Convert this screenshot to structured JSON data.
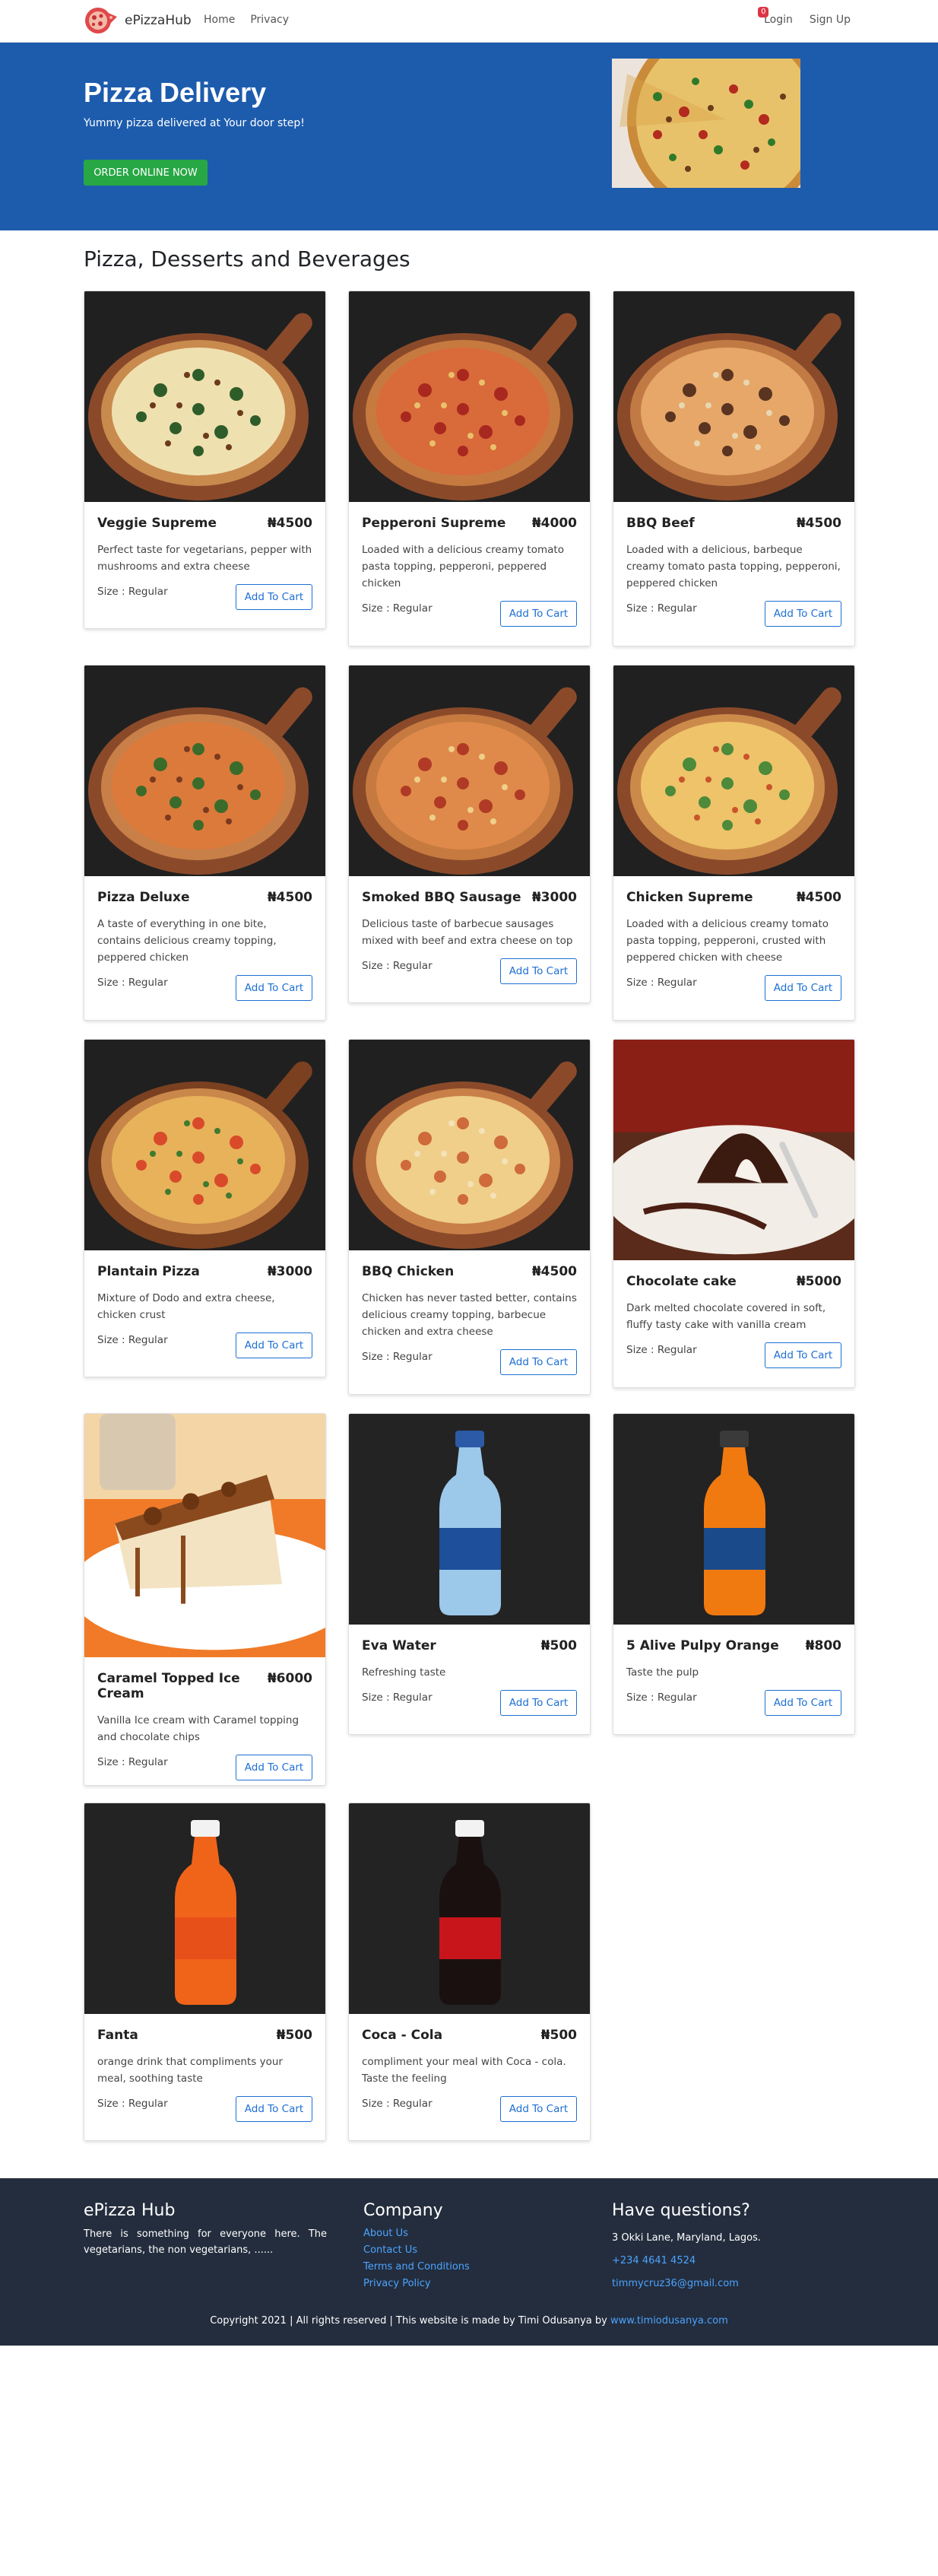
{
  "navbar": {
    "brand": "ePizzaHub",
    "links": [
      "Home",
      "Privacy"
    ],
    "cart_count": "0",
    "login": "Login",
    "signup": "Sign Up"
  },
  "hero": {
    "title": "Pizza Delivery",
    "subtitle": "Yummy pizza delivered at Your door step!",
    "button": "ORDER ONLINE NOW"
  },
  "section_title": "Pizza, Desserts and Beverages",
  "labels": {
    "size": "Size : Regular",
    "add_to_cart": "Add To Cart"
  },
  "products": [
    {
      "name": "Veggie Supreme",
      "price": "₦4500",
      "description": "Perfect taste for vegetarians, pepper with mushrooms and extra cheese",
      "image": "pizza-veggie"
    },
    {
      "name": "Pepperoni Supreme",
      "price": "₦4000",
      "description": "Loaded with a delicious creamy tomato pasta topping, pepperoni, peppered chicken",
      "image": "pizza-pepperoni"
    },
    {
      "name": "BBQ Beef",
      "price": "₦4500",
      "description": "Loaded with a delicious, barbeque creamy tomato pasta topping, pepperoni, peppered chicken",
      "image": "pizza-bbq-beef"
    },
    {
      "name": "Pizza Deluxe",
      "price": "₦4500",
      "description": "A taste of everything in one bite, contains delicious creamy topping, peppered chicken",
      "image": "pizza-deluxe"
    },
    {
      "name": "Smoked BBQ Sausage",
      "price": "₦3000",
      "description": "Delicious taste of barbecue sausages mixed with beef and extra cheese on top",
      "image": "pizza-sausage"
    },
    {
      "name": "Chicken Supreme",
      "price": "₦4500",
      "description": "Loaded with a delicious creamy tomato pasta topping, pepperoni, crusted with peppered chicken with cheese",
      "image": "pizza-chicken"
    },
    {
      "name": "Plantain Pizza",
      "price": "₦3000",
      "description": "Mixture of Dodo and extra cheese, chicken crust",
      "image": "pizza-plantain"
    },
    {
      "name": "BBQ Chicken",
      "price": "₦4500",
      "description": "Chicken has never tasted better, contains delicious creamy topping, barbecue chicken and extra cheese",
      "image": "pizza-bbq-chicken"
    },
    {
      "name": "Chocolate cake",
      "price": "₦5000",
      "description": "Dark melted chocolate covered in soft, fluffy tasty cake with vanilla cream",
      "image": "chocolate-cake"
    },
    {
      "name": "Caramel Topped Ice Cream",
      "price": "₦6000",
      "description": "Vanilla Ice cream with Caramel topping and chocolate chips",
      "image": "caramel-ice-cream"
    },
    {
      "name": "Eva Water",
      "price": "₦500",
      "description": "Refreshing taste",
      "image": "water-bottle"
    },
    {
      "name": "5 Alive Pulpy Orange",
      "price": "₦800",
      "description": "Taste the pulp",
      "image": "orange-bottle"
    },
    {
      "name": "Fanta",
      "price": "₦500",
      "description": "orange drink that compliments your meal, soothing taste",
      "image": "fanta-bottle"
    },
    {
      "name": "Coca - Cola",
      "price": "₦500",
      "description": "compliment your meal with Coca - cola. Taste the feeling",
      "image": "cola-bottle"
    }
  ],
  "footer": {
    "brand": "ePizza Hub",
    "about": "There is something for everyone here. The vegetarians, the non vegetarians, ......",
    "company_heading": "Company",
    "company_links": [
      "About Us",
      "Contact Us",
      "Terms and Conditions",
      "Privacy Policy"
    ],
    "questions_heading": "Have questions?",
    "address": "3 Okki Lane, Maryland, Lagos.",
    "phone": "+234 4641 4524",
    "email": "timmycruz36@gmail.com",
    "copyright": "Copyright 2021 | All rights reserved | This website is made by Timi Odusanya by",
    "website": "www.timiodusanya.com"
  }
}
